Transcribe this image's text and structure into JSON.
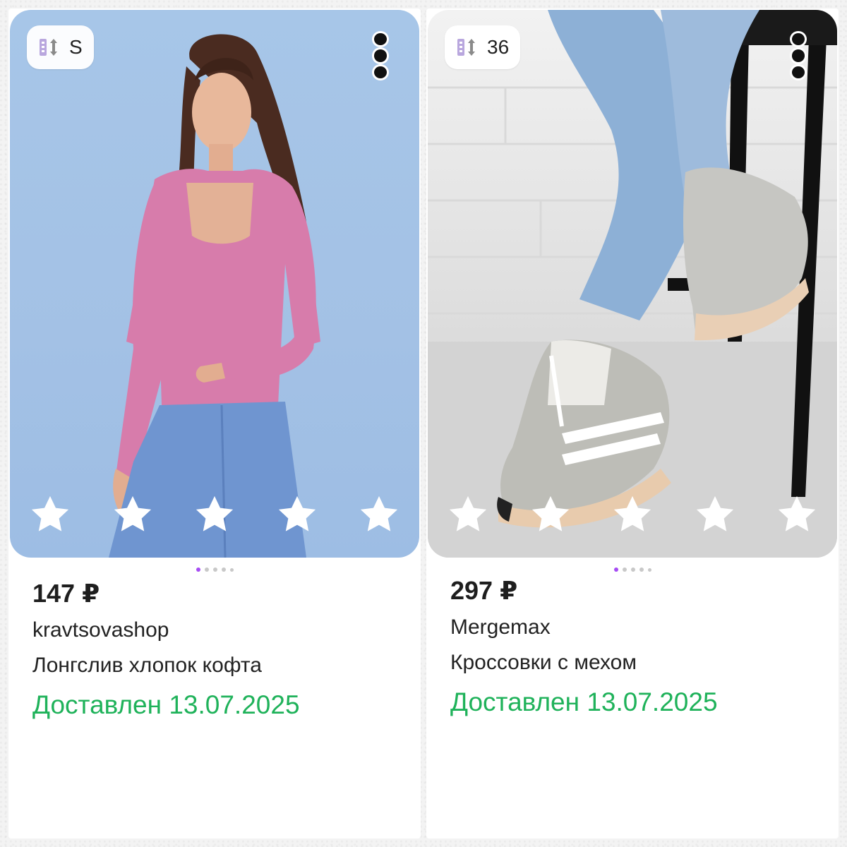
{
  "products": [
    {
      "size_label": "S",
      "price": "147 ₽",
      "seller": "kravtsovashop",
      "title": "Лонгслив хлопок кофта",
      "status": "Доставлен 13.07.2025",
      "rating_stars": 5,
      "gallery_pages": 5,
      "gallery_active": 0
    },
    {
      "size_label": "36",
      "price": "297 ₽",
      "seller": "Mergemax",
      "title": "Кроссовки с мехом",
      "status": "Доставлен 13.07.2025",
      "rating_stars": 5,
      "gallery_pages": 5,
      "gallery_active": 0
    }
  ],
  "icons": {
    "size": "size-icon",
    "more": "more-vertical-icon",
    "star": "star-outline-icon"
  },
  "colors": {
    "status_green": "#1fb25a",
    "active_dot": "#a64bf4",
    "star_fill": "#ffffff"
  }
}
